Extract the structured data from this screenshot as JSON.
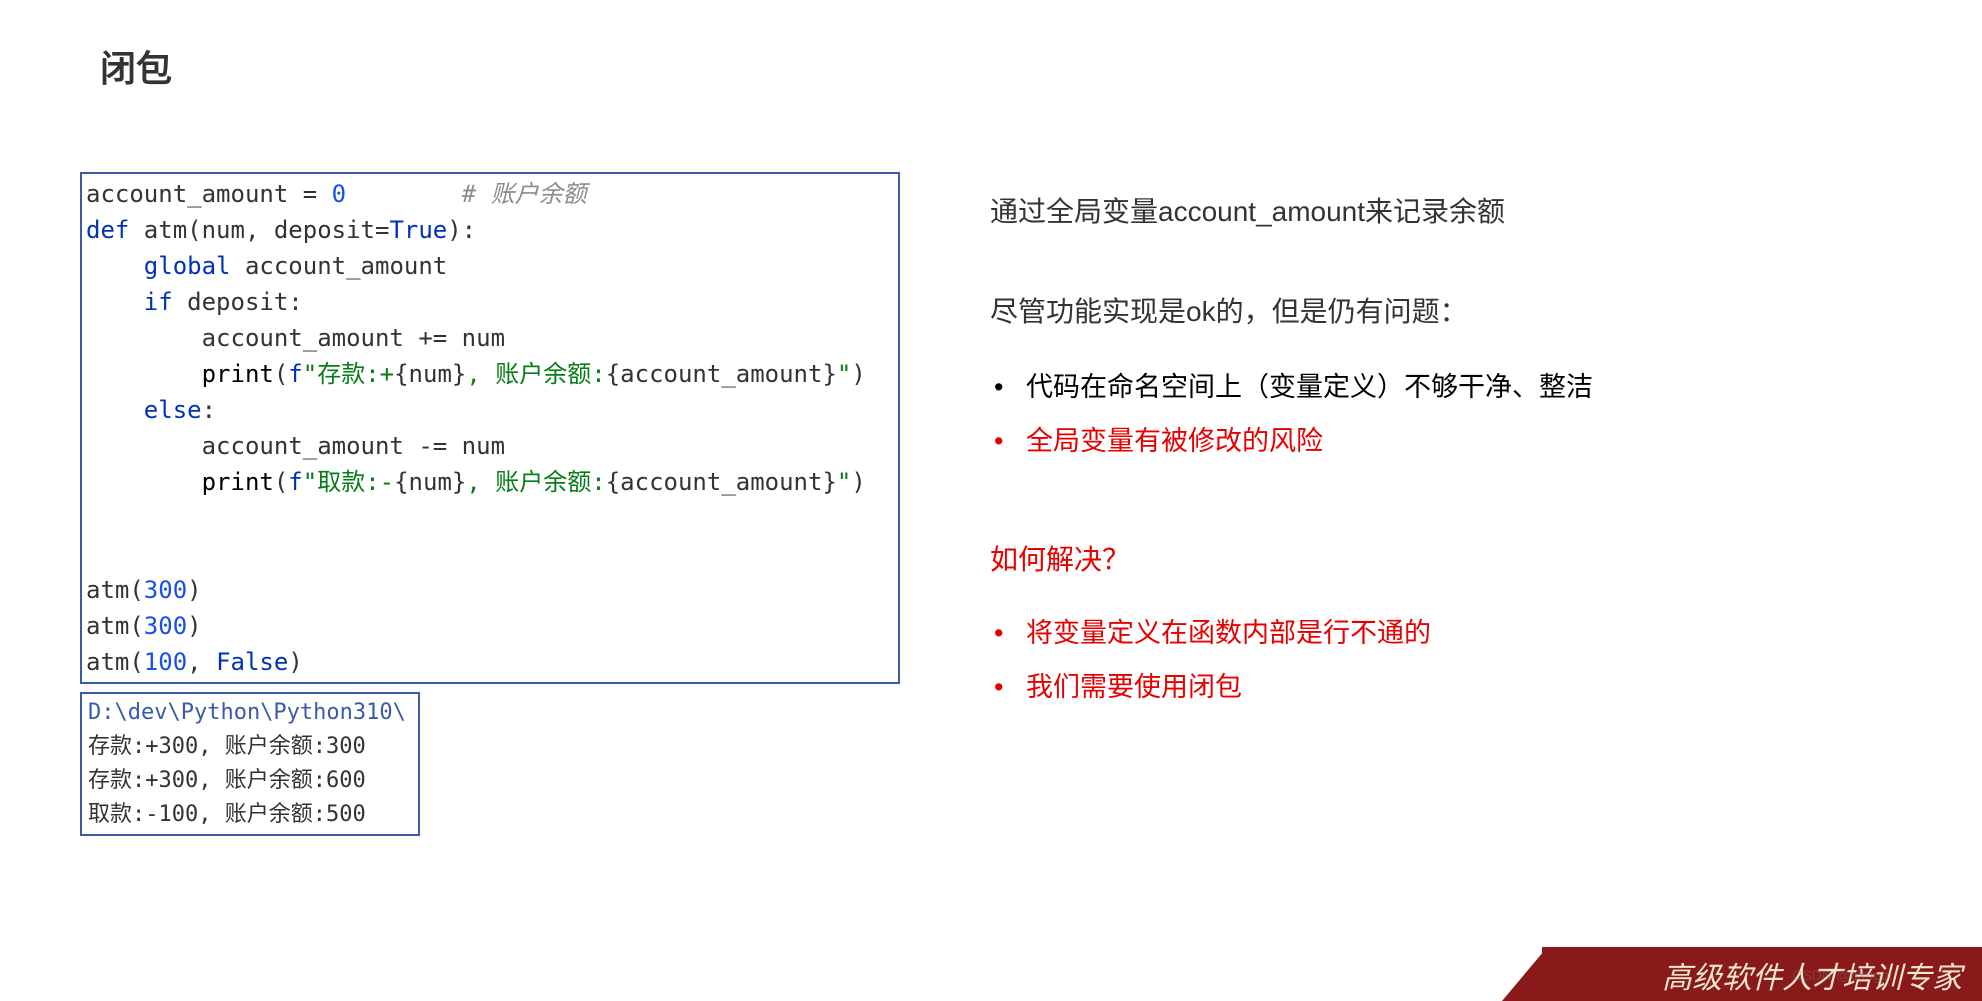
{
  "title": "闭包",
  "code": {
    "lines": [
      {
        "html": "account_amount = <span class=\"num\">0</span>        <span class=\"cmt\"># 账户余额</span>"
      },
      {
        "html": "<span class=\"kw\">def </span>atm(num, deposit=<span class=\"kw\">True</span>):"
      },
      {
        "html": "    <span class=\"kw\">global</span> account_amount"
      },
      {
        "html": "    <span class=\"kw\">if</span> deposit:"
      },
      {
        "html": "        account_amount += num"
      },
      {
        "html": "        <span class=\"builtin\">print</span>(<span class=\"kw\">f</span><span class=\"str\">\"存款:+</span>{num}<span class=\"str\">, 账户余额:</span>{account_amount}<span class=\"str\">\"</span>)"
      },
      {
        "html": "    <span class=\"kw\">else</span>:"
      },
      {
        "html": "        account_amount -= num"
      },
      {
        "html": "        <span class=\"builtin\">print</span>(<span class=\"kw\">f</span><span class=\"str\">\"取款:-</span>{num}<span class=\"str\">, 账户余额:</span>{account_amount}<span class=\"str\">\"</span>)"
      },
      {
        "html": ""
      },
      {
        "html": ""
      },
      {
        "html": "atm(<span class=\"num\">300</span>)"
      },
      {
        "html": "atm(<span class=\"num\">300</span>)"
      },
      {
        "html": "atm(<span class=\"num\">100</span>, <span class=\"kw\">False</span>)"
      }
    ]
  },
  "output": {
    "path": "D:\\dev\\Python\\Python310\\",
    "lines": [
      "存款:+300, 账户余额:300",
      "存款:+300, 账户余额:600",
      "取款:-100, 账户余额:500"
    ]
  },
  "right": {
    "heading": "通过全局变量account_amount来记录余额",
    "subhead": "尽管功能实现是ok的，但是仍有问题：",
    "problems": [
      {
        "text": "代码在命名空间上（变量定义）不够干净、整洁",
        "red": false
      },
      {
        "text": "全局变量有被修改的风险",
        "red": true
      }
    ],
    "question": "如何解决？",
    "solutions": [
      "将变量定义在函数内部是行不通的",
      "我们需要使用闭包"
    ]
  },
  "footer": "高级软件人才培训专家",
  "watermark": "CSDN @pangbi"
}
